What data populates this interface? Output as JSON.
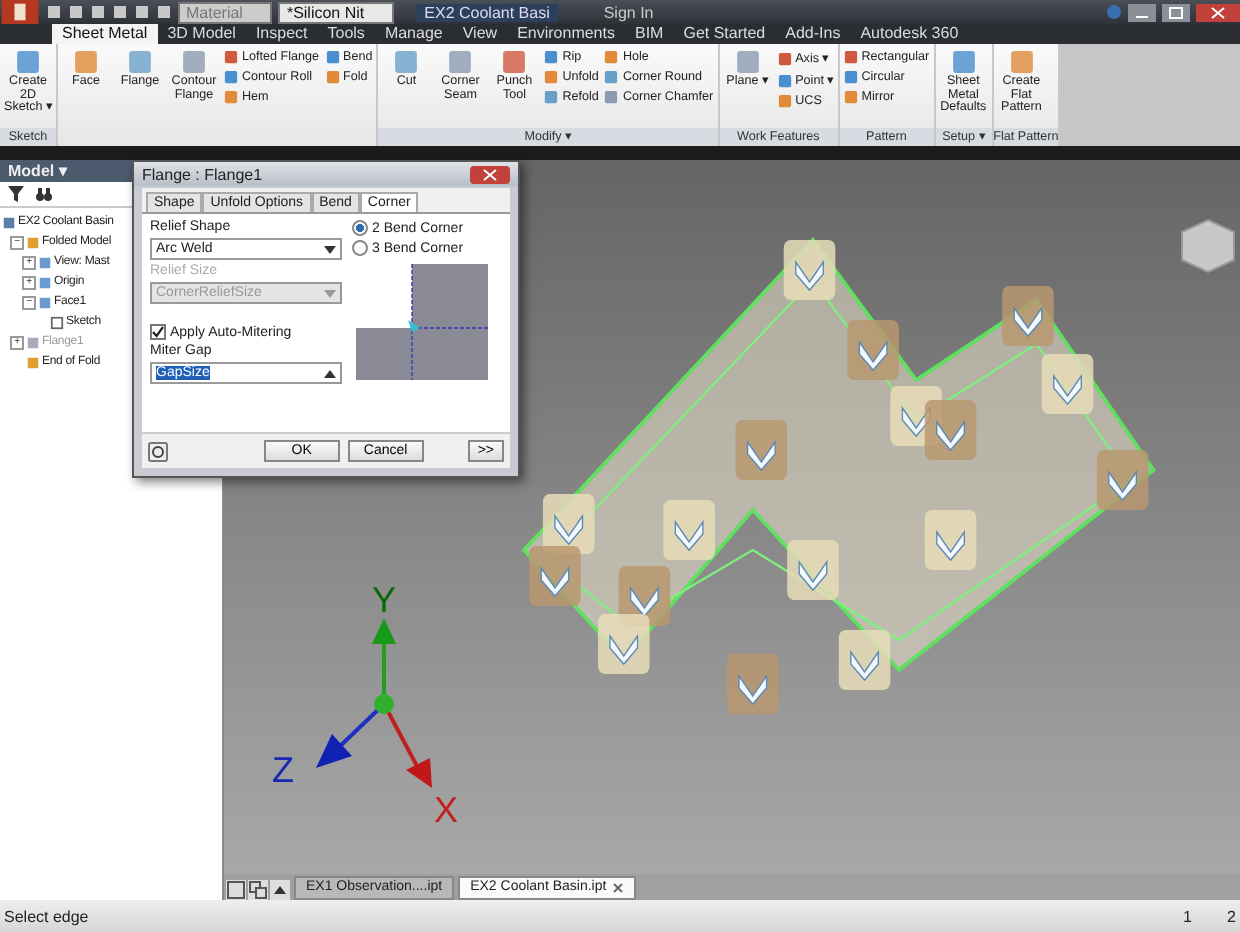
{
  "title_bar": {
    "material": "Material",
    "appearance": "*Silicon Nit",
    "document": "EX2 Coolant Basi",
    "sign_in": "Sign In"
  },
  "ribbon_tabs": [
    {
      "label": "Sheet Metal",
      "selected": true
    },
    {
      "label": "3D Model",
      "selected": false
    },
    {
      "label": "Inspect",
      "selected": false
    },
    {
      "label": "Tools",
      "selected": false
    },
    {
      "label": "Manage",
      "selected": false
    },
    {
      "label": "View",
      "selected": false
    },
    {
      "label": "Environments",
      "selected": false
    },
    {
      "label": "BIM",
      "selected": false
    },
    {
      "label": "Get Started",
      "selected": false
    },
    {
      "label": "Add-Ins",
      "selected": false
    },
    {
      "label": "Autodesk 360",
      "selected": false
    }
  ],
  "ribbon_panels": [
    {
      "label": "Sketch",
      "tools": [
        {
          "kind": "big",
          "label": "Create 2D Sketch ▾"
        }
      ]
    },
    {
      "tools": [
        {
          "kind": "big",
          "label": "Face"
        },
        {
          "kind": "big",
          "label": "Flange"
        },
        {
          "kind": "big",
          "label": "Contour Flange"
        },
        {
          "kind": "stack",
          "items": [
            "Lofted Flange",
            "Contour Roll",
            "Hem"
          ]
        },
        {
          "kind": "stack",
          "items": [
            "Bend",
            "Fold"
          ]
        }
      ]
    },
    {
      "label": "Modify ▾",
      "tools": [
        {
          "kind": "big",
          "label": "Cut"
        },
        {
          "kind": "big",
          "label": "Corner Seam"
        },
        {
          "kind": "big",
          "label": "Punch Tool"
        },
        {
          "kind": "stack",
          "items": [
            "Rip",
            "Unfold",
            "Refold"
          ]
        },
        {
          "kind": "stack",
          "items": [
            "Hole",
            "Corner Round",
            "Corner Chamfer"
          ]
        }
      ]
    },
    {
      "label": "Work Features",
      "tools": [
        {
          "kind": "big",
          "label": "Plane ▾"
        },
        {
          "kind": "stack",
          "items": [
            "Axis ▾",
            "Point ▾",
            "UCS"
          ]
        }
      ]
    },
    {
      "label": "Pattern",
      "tools": [
        {
          "kind": "stack",
          "items": [
            "Rectangular",
            "Circular",
            "Mirror"
          ]
        }
      ]
    },
    {
      "label": "Setup ▾",
      "tools": [
        {
          "kind": "big",
          "label": "Sheet Metal Defaults"
        }
      ]
    },
    {
      "label": "Flat Pattern",
      "tools": [
        {
          "kind": "big",
          "label": "Create Flat Pattern"
        }
      ]
    }
  ],
  "browser": {
    "header": "Model ▾",
    "tree": [
      {
        "label": "EX2 Coolant Basin",
        "dimmed": false,
        "children": [
          {
            "label": "Folded Model",
            "toggle": "−",
            "dimmed": false,
            "children": [
              {
                "label": "View: Mast",
                "toggle": "+",
                "dimmed": false
              },
              {
                "label": "Origin",
                "toggle": "+",
                "dimmed": false
              },
              {
                "label": "Face1",
                "toggle": "−",
                "dimmed": false,
                "children": [
                  {
                    "label": "Sketch",
                    "dimmed": false
                  }
                ]
              }
            ]
          },
          {
            "label": "Flange1",
            "toggle": "+",
            "dimmed": true
          },
          {
            "label": "End of Fold",
            "dimmed": false
          }
        ]
      }
    ]
  },
  "dialog": {
    "title": "Flange : Flange1",
    "tabs": [
      {
        "label": "Shape",
        "selected": false
      },
      {
        "label": "Unfold Options",
        "selected": false
      },
      {
        "label": "Bend",
        "selected": false
      },
      {
        "label": "Corner",
        "selected": true
      }
    ],
    "relief_shape": {
      "label": "Relief Shape",
      "value": "Arc Weld",
      "disabled": false
    },
    "relief_size": {
      "label": "Relief Size",
      "value": "CornerReliefSize",
      "disabled": true
    },
    "corner_options": [
      {
        "label": "2 Bend Corner",
        "selected": true
      },
      {
        "label": "3 Bend Corner",
        "selected": false
      }
    ],
    "auto_mitering": {
      "label": "Apply Auto-Mitering",
      "checked": true
    },
    "miter_gap": {
      "label": "Miter Gap",
      "value": "GapSize"
    },
    "buttons": [
      "OK",
      "Cancel",
      ">>"
    ]
  },
  "viewport": {
    "axis_labels": {
      "x": "X",
      "y": "Y",
      "z": "Z"
    }
  },
  "document_tabs": [
    {
      "label": "EX1 Observation....ipt",
      "selected": false
    },
    {
      "label": "EX2 Coolant Basin.ipt",
      "selected": true
    }
  ],
  "status_bar": {
    "prompt": "Select edge",
    "pages": [
      "1",
      "2"
    ]
  }
}
